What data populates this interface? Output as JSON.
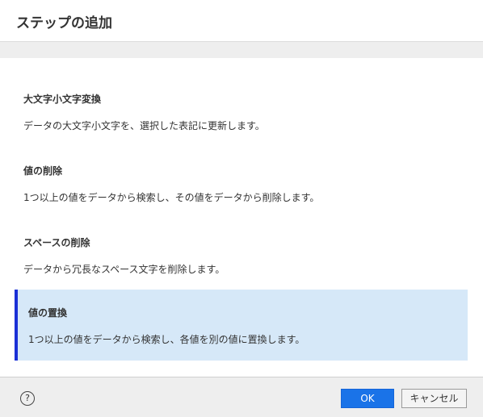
{
  "dialog": {
    "title": "ステップの追加"
  },
  "steps": [
    {
      "name": "大文字小文字変換",
      "description": "データの大文字小文字を、選択した表記に更新します。",
      "selected": false
    },
    {
      "name": "値の削除",
      "description": "1つ以上の値をデータから検索し、その値をデータから削除します。",
      "selected": false
    },
    {
      "name": "スペースの削除",
      "description": "データから冗長なスペース文字を削除します。",
      "selected": false
    },
    {
      "name": "値の置換",
      "description": "1つ以上の値をデータから検索し、各値を別の値に置換します。",
      "selected": true
    }
  ],
  "footer": {
    "help_symbol": "?",
    "help_icon": "question-circle",
    "ok_label": "OK",
    "cancel_label": "キャンセル"
  },
  "colors": {
    "primary_button": "#1a73e8",
    "selected_background": "#d6e8f8",
    "selected_accent": "#1a2fd6",
    "footer_background": "#eeeeee"
  }
}
